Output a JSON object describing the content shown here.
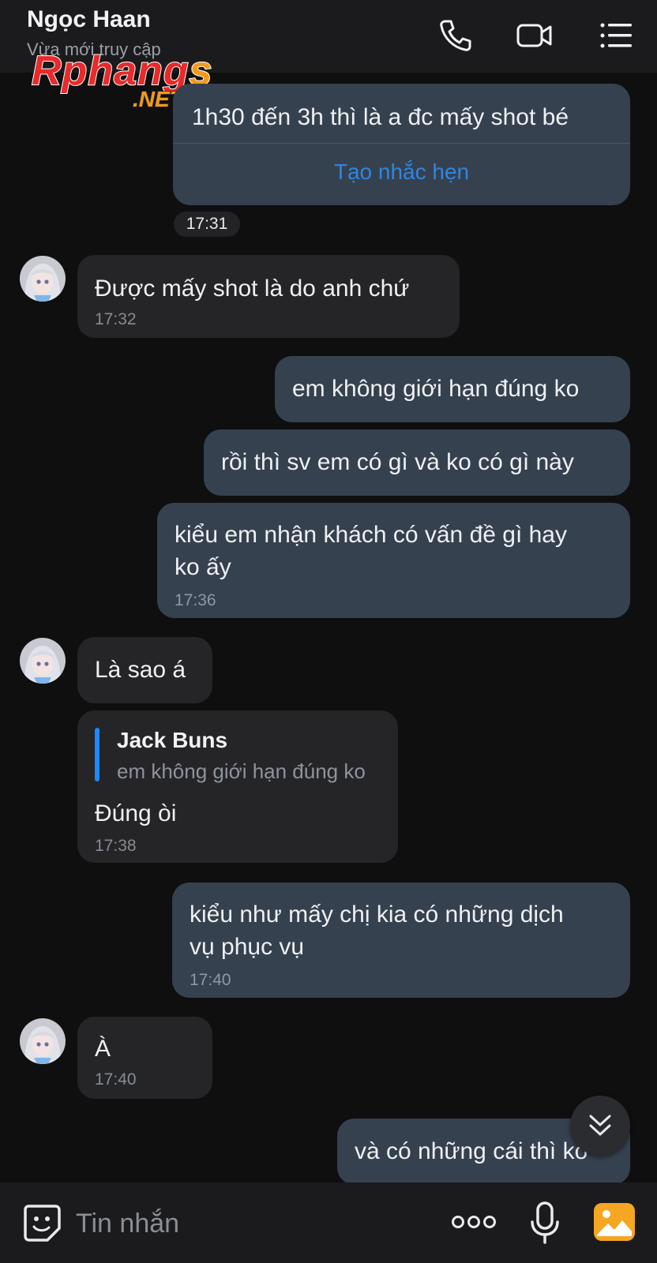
{
  "header": {
    "contact_name": "Ngọc Haan",
    "status": "Vừa mới truy cập",
    "icons": [
      "phone-icon",
      "video-call-icon",
      "menu-icon"
    ]
  },
  "watermark": {
    "main": "Rphangs",
    "sub": ".NET"
  },
  "messages": [
    {
      "id": "m1",
      "direction": "outgoing",
      "text": "1h30 đến 3h thì là a đc mấy shot bé",
      "action": "Tạo nhắc hẹn"
    },
    {
      "id": "t1",
      "type": "time",
      "text": "17:31"
    },
    {
      "id": "m2",
      "direction": "incoming",
      "text": "Được mấy shot là do anh chứ",
      "time": "17:32"
    },
    {
      "id": "m3",
      "direction": "outgoing",
      "text": "em không giới hạn đúng ko"
    },
    {
      "id": "m4",
      "direction": "outgoing",
      "text": "rồi thì sv em có gì và ko có gì này"
    },
    {
      "id": "m5",
      "direction": "outgoing",
      "line1": "kiểu em nhận khách có vấn đề gì hay",
      "line2": "ko ấy",
      "time": "17:36"
    },
    {
      "id": "m6",
      "direction": "incoming",
      "text": "Là sao á"
    },
    {
      "id": "m7",
      "direction": "incoming",
      "quote_name": "Jack Buns",
      "quote_text": "em không giới hạn đúng ko",
      "text": "Đúng òi",
      "time": "17:38"
    },
    {
      "id": "m8",
      "direction": "outgoing",
      "line1": "kiểu như mấy chị kia có những dịch",
      "line2": "vụ phục vụ",
      "time": "17:40"
    },
    {
      "id": "m9",
      "direction": "incoming",
      "text": "À",
      "time": "17:40"
    },
    {
      "id": "m10",
      "direction": "outgoing",
      "text": "và có những cái thì ko"
    }
  ],
  "composer": {
    "placeholder": "Tin nhắn"
  },
  "colors": {
    "background": "#0f0f10",
    "outgoing_bubble": "#36414f",
    "incoming_bubble": "#252527",
    "link": "#2f86e0",
    "quote_bar": "#1e88ff",
    "gallery_icon": "#f5a623"
  }
}
